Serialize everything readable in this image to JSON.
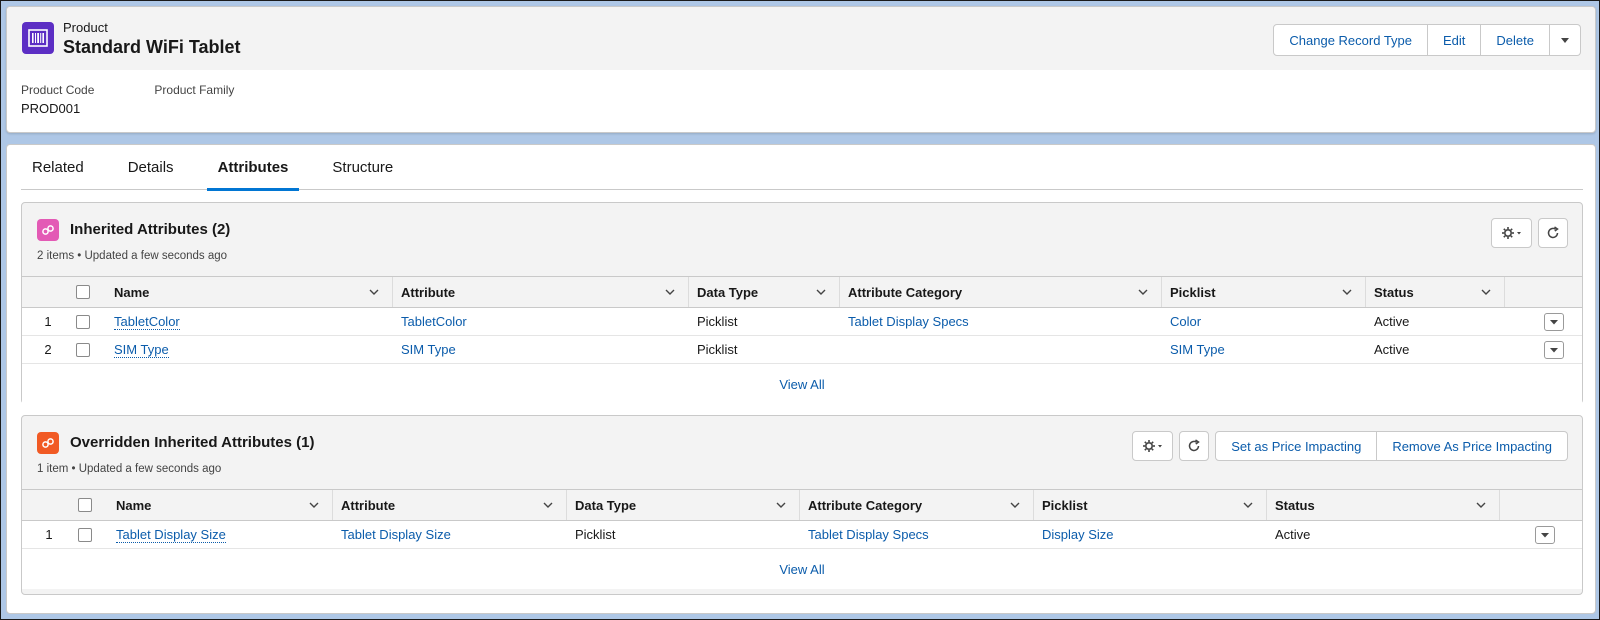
{
  "header": {
    "object_type": "Product",
    "record_title": "Standard WiFi Tablet",
    "buttons": {
      "change_record_type": "Change Record Type",
      "edit": "Edit",
      "delete": "Delete"
    },
    "fields": [
      {
        "label": "Product Code",
        "value": "PROD001"
      },
      {
        "label": "Product Family",
        "value": ""
      }
    ]
  },
  "tabs": [
    {
      "label": "Related"
    },
    {
      "label": "Details"
    },
    {
      "label": "Attributes",
      "active": true
    },
    {
      "label": "Structure"
    }
  ],
  "inherited": {
    "title": "Inherited Attributes (2)",
    "subtitle": "2 items • Updated a few seconds ago",
    "columns": [
      "Name",
      "Attribute",
      "Data Type",
      "Attribute Category",
      "Picklist",
      "Status"
    ],
    "rows": [
      {
        "num": "1",
        "name": "TabletColor",
        "attribute": "TabletColor",
        "data_type": "Picklist",
        "category": "Tablet Display Specs",
        "picklist": "Color",
        "status": "Active"
      },
      {
        "num": "2",
        "name": "SIM Type",
        "attribute": "SIM Type",
        "data_type": "Picklist",
        "category": "",
        "picklist": "SIM Type",
        "status": "Active"
      }
    ],
    "view_all": "View All"
  },
  "overridden": {
    "title": "Overridden Inherited Attributes (1)",
    "subtitle": "1 item • Updated a few seconds ago",
    "buttons": {
      "set_price": "Set as Price Impacting",
      "remove_price": "Remove As Price Impacting"
    },
    "columns": [
      "Name",
      "Attribute",
      "Data Type",
      "Attribute Category",
      "Picklist",
      "Status"
    ],
    "rows": [
      {
        "num": "1",
        "name": "Tablet Display Size",
        "attribute": "Tablet Display Size",
        "data_type": "Picklist",
        "category": "Tablet Display Specs",
        "picklist": "Display Size",
        "status": "Active"
      }
    ],
    "view_all": "View All"
  },
  "colors": {
    "brand_blue": "#0176d3",
    "link_blue": "#0b5cab",
    "product_icon": "#5c2ec4",
    "inherited_icon": "#e35ab5",
    "overridden_icon": "#f15a24"
  },
  "icons": {
    "product": "barcode-icon",
    "inherited": "attribute-icon",
    "overridden": "attribute-icon",
    "settings": "gear-icon",
    "refresh": "refresh-icon",
    "more": "chevron-down-icon"
  }
}
